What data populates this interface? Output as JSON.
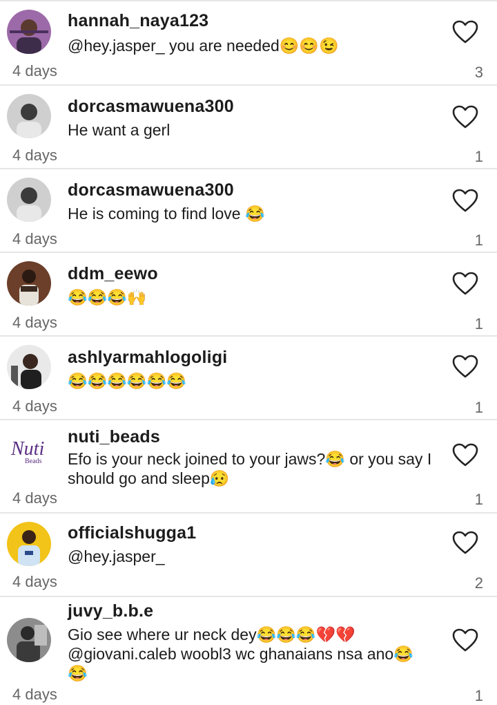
{
  "comments": [
    {
      "username": "hannah_naya123",
      "text": "@hey.jasper_  you are needed😊😊😉",
      "age": "4 days",
      "likes": "3",
      "avatar_bg": "#9c6aa8"
    },
    {
      "username": "dorcasmawuena300",
      "text": "He want a gerl",
      "age": "4 days",
      "likes": "1",
      "avatar_bg": "#8a8a8a"
    },
    {
      "username": "dorcasmawuena300",
      "text": "He is coming to find love 😂",
      "age": "4 days",
      "likes": "1",
      "avatar_bg": "#8a8a8a"
    },
    {
      "username": "ddm_eewo",
      "text": "😂😂😂🙌",
      "age": "4 days",
      "likes": "1",
      "avatar_bg": "#6b3f2a"
    },
    {
      "username": "ashlyarmahlogoligi",
      "text": "😂😂😂😂😂😂",
      "age": "4 days",
      "likes": "1",
      "avatar_bg": "#9b9b9b"
    },
    {
      "username": "nuti_beads",
      "text": "Efo  is your neck joined to your jaws?😂 or you say I should go and sleep😥",
      "age": "4 days",
      "likes": "1",
      "avatar_bg": "#ffffff",
      "avatar_logo_text": "Nuti",
      "avatar_logo_sub": "Beads"
    },
    {
      "username": "officialshugga1",
      "text": "@hey.jasper_",
      "age": "4 days",
      "likes": "2",
      "avatar_bg": "#f2c318"
    },
    {
      "username": "juvy_b.b.e",
      "text": "Gio see where ur neck dey😂😂😂💔💔 @giovani.caleb  woobl3 wc ghanaians nsa ano😂😂",
      "age": "4 days",
      "likes": "1",
      "avatar_bg": "#555555"
    }
  ],
  "icons": {
    "like": "heart-outline-icon"
  }
}
